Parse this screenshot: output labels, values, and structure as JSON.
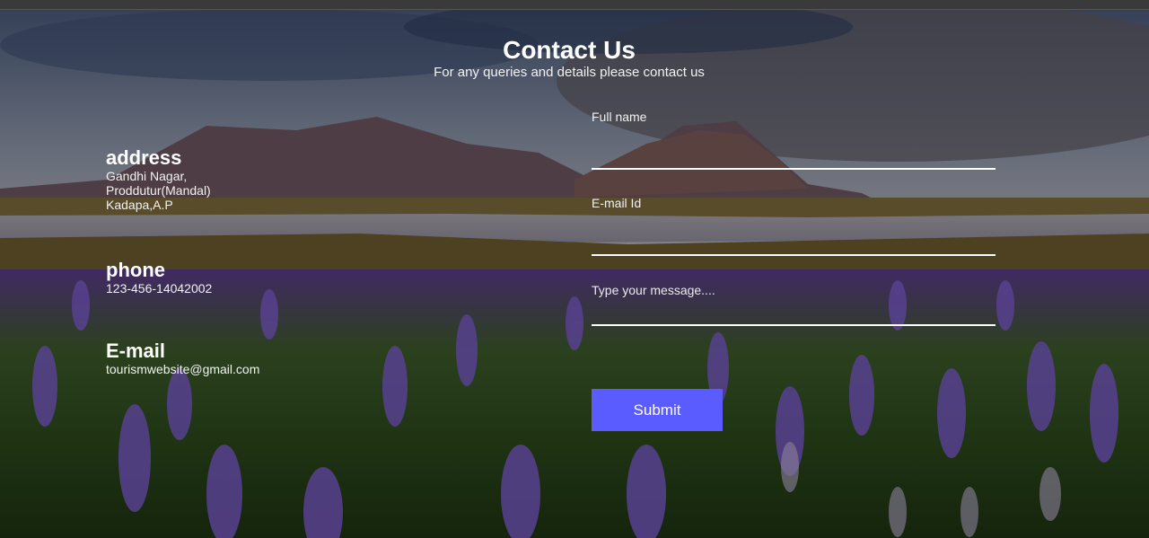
{
  "header": {
    "title": "Contact Us",
    "subtitle": "For any queries and details please contact us"
  },
  "contact_info": {
    "address": {
      "heading": "address",
      "lines": [
        "Gandhi Nagar,",
        "Proddutur(Mandal)",
        "Kadapa,A.P"
      ]
    },
    "phone": {
      "heading": "phone",
      "value": "123-456-14042002"
    },
    "email": {
      "heading": "E-mail",
      "value": "tourismwebsite@gmail.com"
    }
  },
  "form": {
    "full_name": {
      "label": "Full name",
      "value": ""
    },
    "email_id": {
      "label": "E-mail Id",
      "value": ""
    },
    "message": {
      "placeholder": "Type your message....",
      "value": ""
    },
    "submit_label": "Submit"
  },
  "colors": {
    "submit_button": "#5a5cff",
    "field_underline": "#ffffff",
    "text": "#ffffff"
  }
}
